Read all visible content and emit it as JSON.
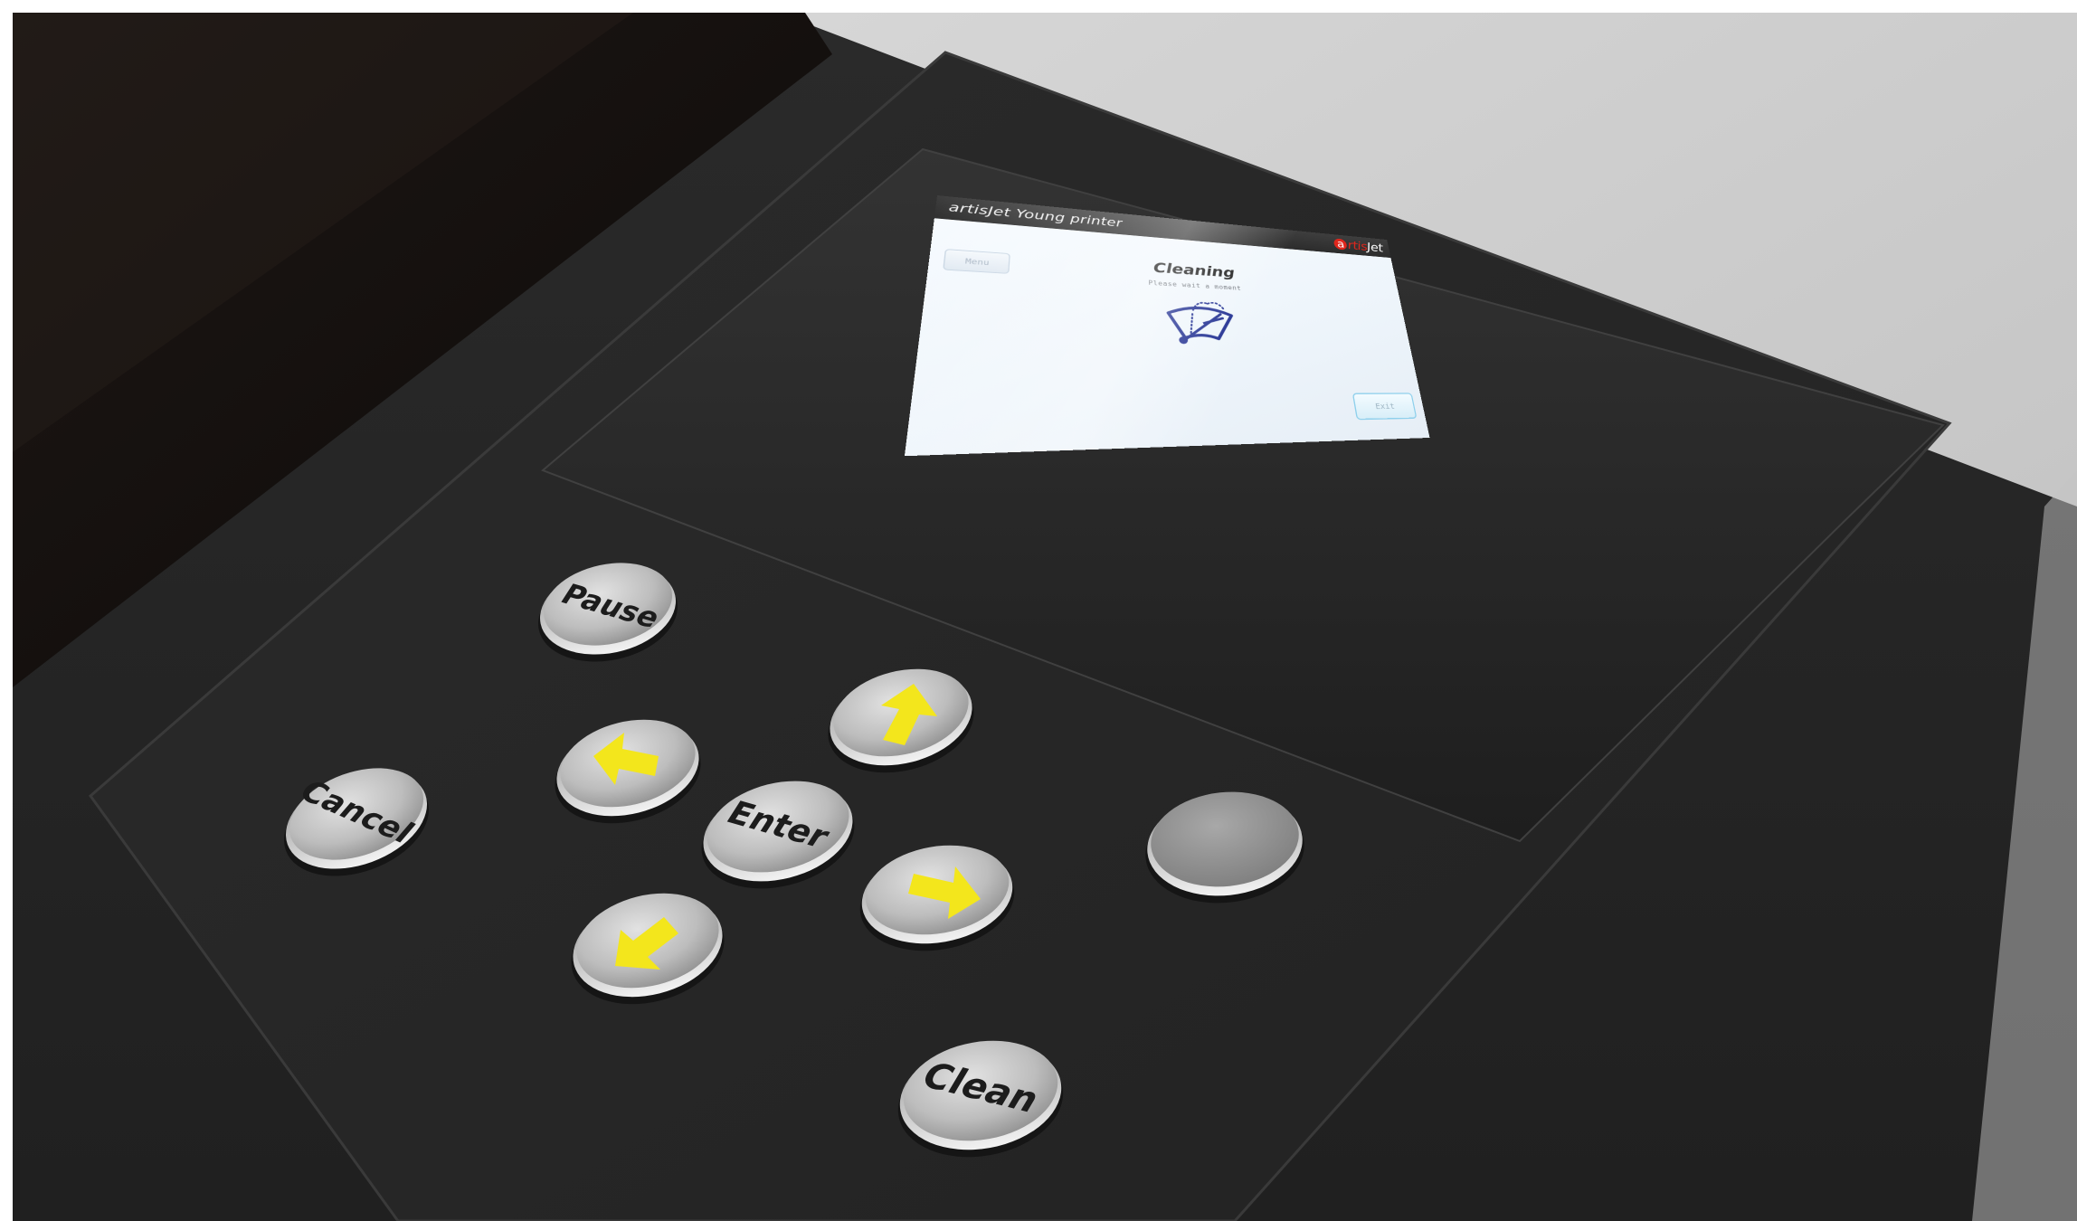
{
  "screen": {
    "title": "artisJet Young printer",
    "brand": {
      "a": "a",
      "rest_red": "rtis",
      "rest_white": "Jet",
      "accent_color": "#e0261c"
    },
    "heading": "Cleaning",
    "subtitle": "Please wait a moment",
    "icon": "wiper-cleaning-icon",
    "menu_button": "Menu",
    "exit_button": "Exit"
  },
  "keypad": {
    "pause": "Pause",
    "cancel": "Cancel",
    "enter": "Enter",
    "clean": "Clean",
    "arrow_color": "#f3e61c",
    "arrows": [
      "arrow-up-icon",
      "arrow-left-icon",
      "arrow-right-icon",
      "arrow-down-icon"
    ]
  }
}
